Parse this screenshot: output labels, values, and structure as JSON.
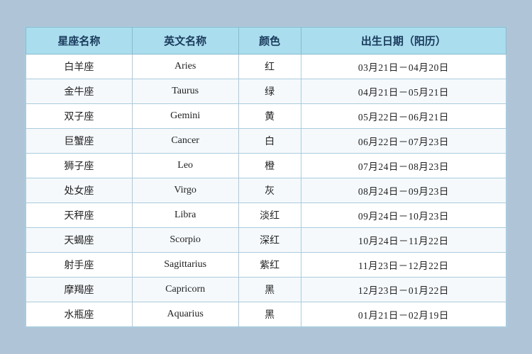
{
  "table": {
    "headers": [
      "星座名称",
      "英文名称",
      "颜色",
      "出生日期（阳历）"
    ],
    "rows": [
      {
        "chinese": "白羊座",
        "english": "Aries",
        "color": "红",
        "date": "03月21日－04月20日"
      },
      {
        "chinese": "金牛座",
        "english": "Taurus",
        "color": "绿",
        "date": "04月21日－05月21日"
      },
      {
        "chinese": "双子座",
        "english": "Gemini",
        "color": "黄",
        "date": "05月22日－06月21日"
      },
      {
        "chinese": "巨蟹座",
        "english": "Cancer",
        "color": "白",
        "date": "06月22日－07月23日"
      },
      {
        "chinese": "狮子座",
        "english": "Leo",
        "color": "橙",
        "date": "07月24日－08月23日"
      },
      {
        "chinese": "处女座",
        "english": "Virgo",
        "color": "灰",
        "date": "08月24日－09月23日"
      },
      {
        "chinese": "天秤座",
        "english": "Libra",
        "color": "淡红",
        "date": "09月24日－10月23日"
      },
      {
        "chinese": "天蝎座",
        "english": "Scorpio",
        "color": "深红",
        "date": "10月24日－11月22日"
      },
      {
        "chinese": "射手座",
        "english": "Sagittarius",
        "color": "紫红",
        "date": "11月23日－12月22日"
      },
      {
        "chinese": "摩羯座",
        "english": "Capricorn",
        "color": "黑",
        "date": "12月23日－01月22日"
      },
      {
        "chinese": "水瓶座",
        "english": "Aquarius",
        "color": "黑",
        "date": "01月21日－02月19日"
      }
    ]
  }
}
